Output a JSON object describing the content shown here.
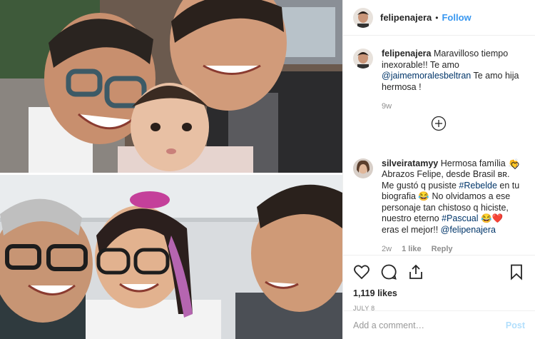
{
  "header": {
    "username": "felipenajera",
    "separator": "•",
    "follow_label": "Follow"
  },
  "caption": {
    "username": "felipenajera",
    "text_1": "Maravilloso tiempo inexorable!! Te amo ",
    "mention": "@jaimemoralesbeltran",
    "text_2": " Te amo hija hermosa !",
    "age": "9w"
  },
  "comment": {
    "username": "silveiratamyy",
    "text_1": "Hermosa família 👏 Abrazos Felipe, desde Brasil ʙʀ. Me gustó q pusiste ",
    "hashtag_1": "#Rebelde",
    "text_2": " en tu biografia 😂 No olvidamos a ese personaje tan chistoso q hiciste, nuestro eterno ",
    "hashtag_2": "#Pascual",
    "text_3": " 😂❤️ eras el mejor!! ",
    "mention": "@felipenajera",
    "age": "2w",
    "likes": "1 like",
    "reply_label": "Reply"
  },
  "actions": {
    "likes_count": "1,119 likes",
    "date": "JULY 8",
    "comment_placeholder": "Add a comment…",
    "post_label": "Post"
  },
  "icons": [
    "heart-icon",
    "comment-icon",
    "share-icon",
    "bookmark-icon",
    "plus-circle-icon"
  ],
  "colors": {
    "link": "#003569",
    "follow": "#3897f0",
    "post_disabled": "#b2dffc",
    "muted": "#8e8e8e"
  }
}
